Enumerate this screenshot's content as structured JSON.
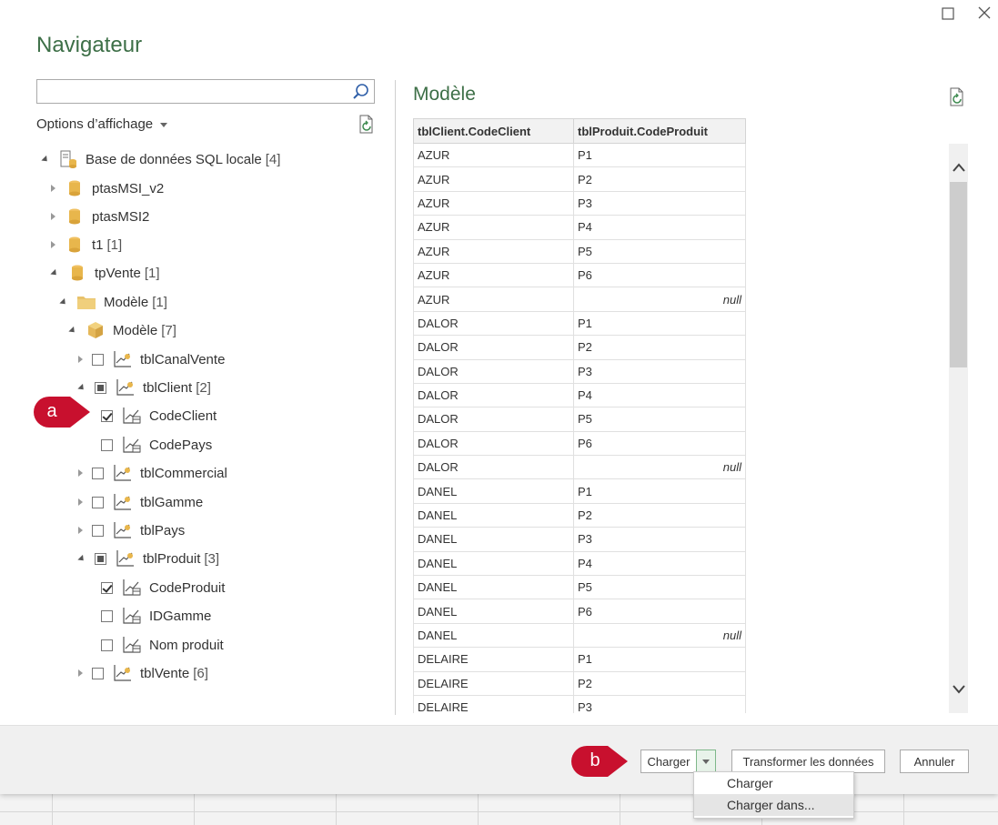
{
  "window": {
    "title": "Navigateur"
  },
  "search": {
    "value": "",
    "placeholder": ""
  },
  "options_label": "Options d’affichage",
  "tree": [
    {
      "label": "Base de données SQL locale",
      "count": "[4]"
    },
    {
      "label": "ptasMSI_v2",
      "count": ""
    },
    {
      "label": "ptasMSI2",
      "count": ""
    },
    {
      "label": "t1",
      "count": "[1]"
    },
    {
      "label": "tpVente",
      "count": "[1]"
    },
    {
      "label": "Modèle",
      "count": "[1]"
    },
    {
      "label": "Modèle",
      "count": "[7]"
    },
    {
      "label": "tblCanalVente",
      "count": ""
    },
    {
      "label": "tblClient",
      "count": "[2]"
    },
    {
      "label": "CodeClient",
      "count": ""
    },
    {
      "label": "CodePays",
      "count": ""
    },
    {
      "label": "tblCommercial",
      "count": ""
    },
    {
      "label": "tblGamme",
      "count": ""
    },
    {
      "label": "tblPays",
      "count": ""
    },
    {
      "label": "tblProduit",
      "count": "[3]"
    },
    {
      "label": "CodeProduit",
      "count": ""
    },
    {
      "label": "IDGamme",
      "count": ""
    },
    {
      "label": "Nom produit",
      "count": ""
    },
    {
      "label": "tblVente",
      "count": "[6]"
    }
  ],
  "preview": {
    "title": "Modèle",
    "columns": [
      "tblClient.CodeClient",
      "tblProduit.CodeProduit"
    ],
    "rows": [
      [
        "AZUR",
        "P1"
      ],
      [
        "AZUR",
        "P2"
      ],
      [
        "AZUR",
        "P3"
      ],
      [
        "AZUR",
        "P4"
      ],
      [
        "AZUR",
        "P5"
      ],
      [
        "AZUR",
        "P6"
      ],
      [
        "AZUR",
        "null"
      ],
      [
        "DALOR",
        "P1"
      ],
      [
        "DALOR",
        "P2"
      ],
      [
        "DALOR",
        "P3"
      ],
      [
        "DALOR",
        "P4"
      ],
      [
        "DALOR",
        "P5"
      ],
      [
        "DALOR",
        "P6"
      ],
      [
        "DALOR",
        "null"
      ],
      [
        "DANEL",
        "P1"
      ],
      [
        "DANEL",
        "P2"
      ],
      [
        "DANEL",
        "P3"
      ],
      [
        "DANEL",
        "P4"
      ],
      [
        "DANEL",
        "P5"
      ],
      [
        "DANEL",
        "P6"
      ],
      [
        "DANEL",
        "null"
      ],
      [
        "DELAIRE",
        "P1"
      ],
      [
        "DELAIRE",
        "P2"
      ],
      [
        "DELAIRE",
        "P3"
      ]
    ]
  },
  "footer": {
    "load_label": "Charger",
    "transform_label": "Transformer les données",
    "cancel_label": "Annuler"
  },
  "load_menu": {
    "items": [
      "Charger",
      "Charger dans..."
    ]
  },
  "callouts": {
    "a": "a",
    "b": "b"
  },
  "colors": {
    "accent_green": "#3d6f47",
    "callout_red": "#c8102e"
  }
}
